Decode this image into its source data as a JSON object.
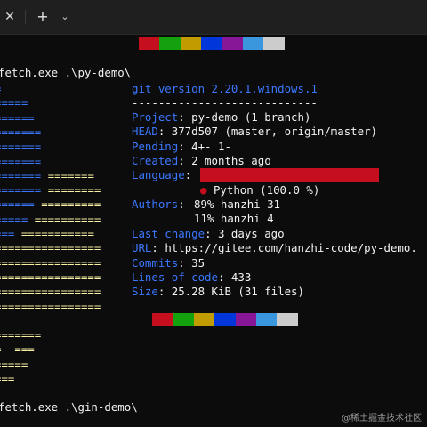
{
  "window": {
    "close_glyph": "✕",
    "new_tab_glyph": "+",
    "dropdown_glyph": "⌄"
  },
  "terminal": {
    "prompt1": "fetch.exe .\\py-demo\\",
    "prompt2": "fetch.exe .\\gin-demo\\",
    "art_lines": [
      {
        "b": "=",
        "y": ""
      },
      {
        "b": "=====",
        "y": ""
      },
      {
        "b": "======",
        "y": ""
      },
      {
        "b": "=======",
        "y": ""
      },
      {
        "b": "=======",
        "y": ""
      },
      {
        "b": "=======",
        "y": ""
      },
      {
        "b": "======= ",
        "y": "======="
      },
      {
        "b": "======= ",
        "y": "========"
      },
      {
        "b": "====== ",
        "y": "========="
      },
      {
        "b": "===== ",
        "y": "=========="
      },
      {
        "b": "=== ",
        "y": "==========="
      },
      {
        "b": "",
        "y": "================"
      },
      {
        "b": "",
        "y": "================"
      },
      {
        "b": "",
        "y": "================"
      },
      {
        "b": "",
        "y": "================"
      },
      {
        "b": "",
        "y": "================"
      },
      {
        "b": "",
        "y": ""
      },
      {
        "b": "",
        "y": "======="
      },
      {
        "b": "",
        "y": "=  ==="
      },
      {
        "b": "",
        "y": "====="
      },
      {
        "b": "",
        "y": "==="
      }
    ],
    "header": "git version 2.20.1.windows.1",
    "separator": "----------------------------",
    "info": [
      {
        "key": "Project",
        "value": "py-demo (1 branch)"
      },
      {
        "key": "HEAD",
        "value": "377d507 (master, origin/master)"
      },
      {
        "key": "Pending",
        "value": "4+- 1-"
      },
      {
        "key": "Created",
        "value": "2 months ago"
      },
      {
        "key": "Language",
        "value": ""
      }
    ],
    "language_detail": "Python (100.0 %)",
    "authors_key": "Authors",
    "authors": [
      {
        "pct": "89%",
        "name": "hanzhi",
        "count": "31"
      },
      {
        "pct": "11%",
        "name": "hanzhi",
        "count": "4"
      }
    ],
    "info2": [
      {
        "key": "Last change",
        "value": "3 days ago"
      },
      {
        "key": "URL",
        "value": "https://gitee.com/hanzhi-code/py-demo."
      },
      {
        "key": "Commits",
        "value": "35"
      },
      {
        "key": "Lines of code",
        "value": "433"
      },
      {
        "key": "Size",
        "value": "25.28 KiB (31 files)"
      }
    ],
    "palette_colors": [
      "#c50f1f",
      "#13a10e",
      "#c19c00",
      "#0037da",
      "#881798",
      "#3a96dd",
      "#cccccc"
    ],
    "language_color": "#c50f1f"
  },
  "watermark": "@稀土掘金技术社区"
}
